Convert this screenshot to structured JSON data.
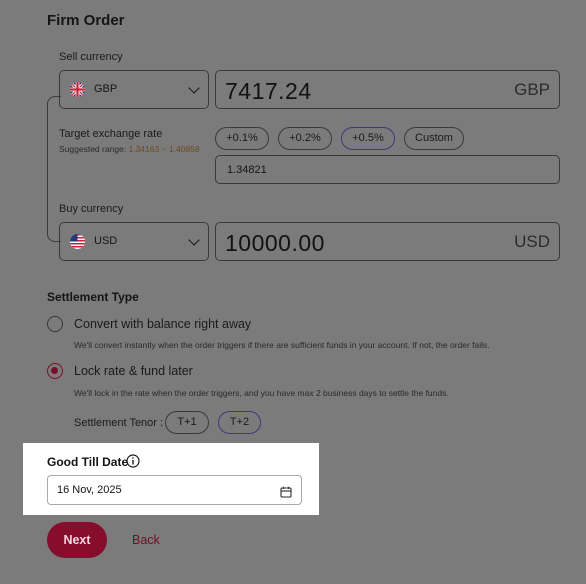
{
  "title": "Firm Order",
  "sell": {
    "label": "Sell currency",
    "currency": "GBP",
    "amount": "7417.24",
    "unit": "GBP",
    "flag_icon": "uk-flag-icon"
  },
  "rate": {
    "label": "Target exchange rate",
    "suggested_prefix": "Suggested range:",
    "suggested_range": "1.34163 ~ 1.40858",
    "value": "1.34821",
    "pills": [
      "+0.1%",
      "+0.2%",
      "+0.5%",
      "Custom"
    ],
    "active_pill": "+0.5%"
  },
  "buy": {
    "label": "Buy currency",
    "currency": "USD",
    "amount": "10000.00",
    "unit": "USD",
    "flag_icon": "us-flag-icon"
  },
  "settlement": {
    "title": "Settlement Type",
    "options": [
      {
        "label": "Convert with balance right away",
        "description": "We'll convert instantly when the order triggers if there are sufficient funds in your account. If not, the order fails.",
        "selected": false
      },
      {
        "label": "Lock rate & fund later",
        "description": "We'll lock in the rate when the order triggers, and you have max 2 business days to settle the funds.",
        "selected": true
      }
    ],
    "tenor_label": "Settlement Tenor :",
    "tenors": [
      "T+1",
      "T+2"
    ],
    "active_tenor": "T+2"
  },
  "good_till": {
    "label": "Good Till Date",
    "info_icon": "info-icon",
    "value": "16 Nov, 2025",
    "calendar_icon": "calendar-icon"
  },
  "actions": {
    "next": "Next",
    "back": "Back"
  },
  "colors": {
    "overlay": "#7b7b7b",
    "accent": "#860d2b",
    "active_pill_border": "#3b3a7a"
  }
}
